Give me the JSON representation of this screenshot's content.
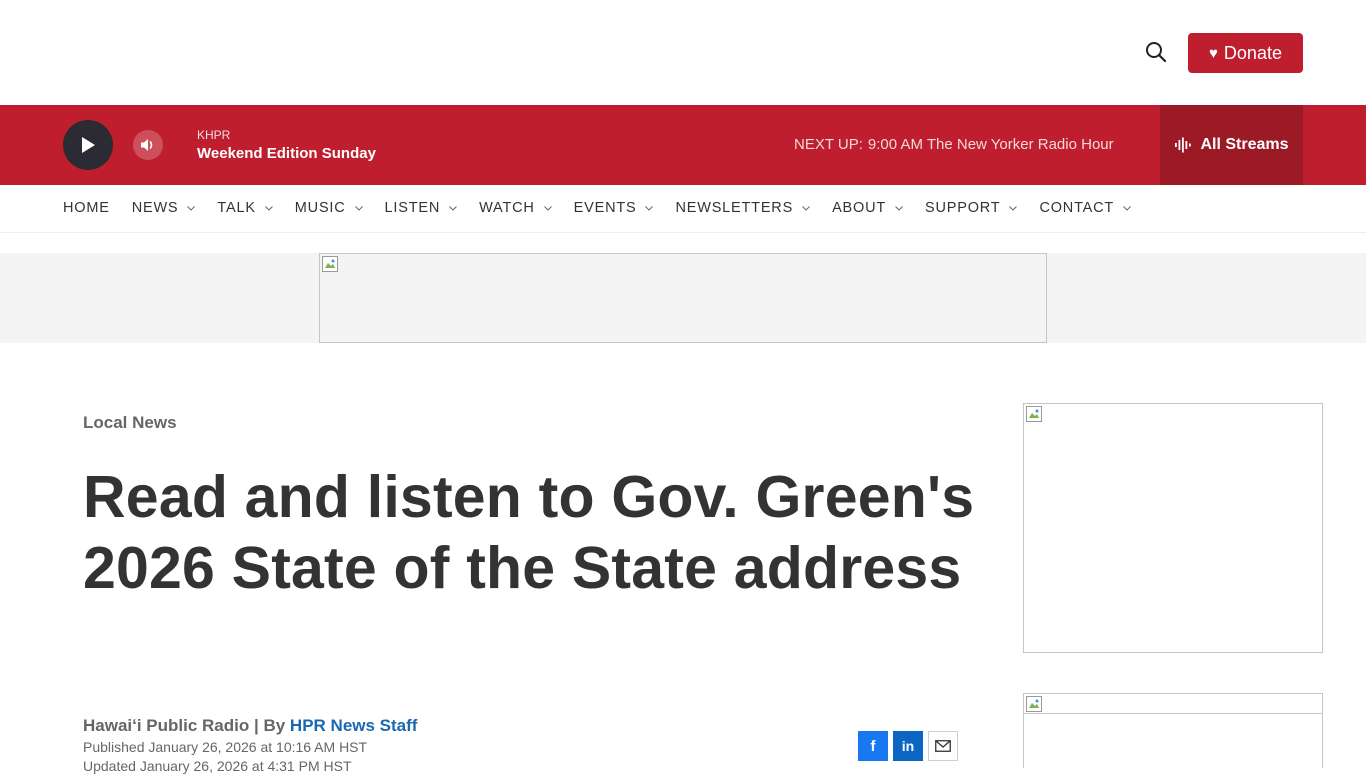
{
  "header": {
    "search_icon": "search-icon",
    "donate_label": "Donate",
    "donate_icon": "heart-icon",
    "brand_color": "#bf1e2e"
  },
  "player": {
    "station": "KHPR",
    "program": "Weekend Edition Sunday",
    "next_up_label": "NEXT UP:",
    "next_up_time": "9:00 AM",
    "next_up_show": "The New Yorker Radio Hour",
    "streams_label": "All Streams",
    "play_icon": "play-icon",
    "volume_icon": "volume-icon",
    "streams_icon": "waveform-icon"
  },
  "nav": {
    "items": [
      {
        "label": "HOME",
        "has_menu": false
      },
      {
        "label": "NEWS",
        "has_menu": true
      },
      {
        "label": "TALK",
        "has_menu": true
      },
      {
        "label": "MUSIC",
        "has_menu": true
      },
      {
        "label": "LISTEN",
        "has_menu": true
      },
      {
        "label": "WATCH",
        "has_menu": true
      },
      {
        "label": "EVENTS",
        "has_menu": true
      },
      {
        "label": "NEWSLETTERS",
        "has_menu": true
      },
      {
        "label": "ABOUT",
        "has_menu": true
      },
      {
        "label": "SUPPORT",
        "has_menu": true
      },
      {
        "label": "CONTACT",
        "has_menu": true
      }
    ]
  },
  "article": {
    "category": "Local News",
    "headline": "Read and listen to Gov. Green's 2026 State of the State address",
    "byline_prefix": "Hawaiʻi Public Radio | By ",
    "author": "HPR News Staff",
    "published": "Published January 26, 2026 at 10:16 AM HST",
    "updated": "Updated January 26, 2026 at 4:31 PM HST"
  },
  "share": {
    "facebook_glyph": "f",
    "linkedin_glyph": "in",
    "facebook_icon": "facebook-icon",
    "linkedin_icon": "linkedin-icon",
    "email_icon": "email-icon"
  }
}
